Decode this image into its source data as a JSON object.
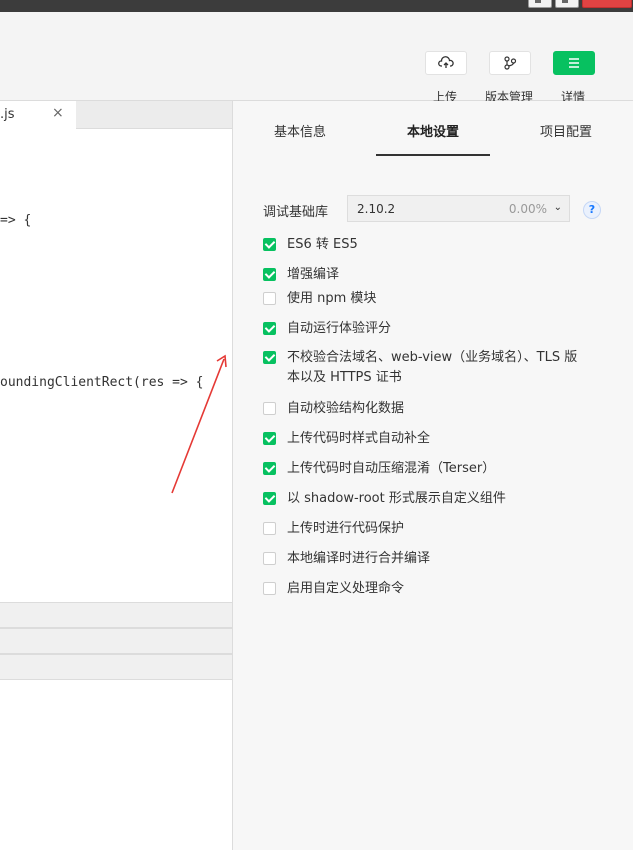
{
  "toolbar": {
    "upload_label": "上传",
    "version_label": "版本管理",
    "details_label": "详情"
  },
  "editor": {
    "tab_name": ".js",
    "tab_close": "×",
    "code_lines": [
      "=> {",
      "oundingClientRect(res => {"
    ]
  },
  "settings": {
    "tabs": [
      {
        "label": "基本信息"
      },
      {
        "label": "本地设置"
      },
      {
        "label": "项目配置"
      }
    ],
    "active_tab": "本地设置",
    "lib_label": "调试基础库",
    "lib_version": "2.10.2",
    "lib_percent": "0.00%",
    "help": "?",
    "options": [
      {
        "label": "ES6 转 ES5",
        "checked": true
      },
      {
        "label": "增强编译",
        "checked": true
      },
      {
        "label": "使用 npm 模块",
        "checked": false
      },
      {
        "label": "自动运行体验评分",
        "checked": true
      },
      {
        "label": "不校验合法域名、web-view（业务域名）、TLS 版本以及 HTTPS 证书",
        "checked": true
      },
      {
        "label": "自动校验结构化数据",
        "checked": false
      },
      {
        "label": "上传代码时样式自动补全",
        "checked": true
      },
      {
        "label": "上传代码时自动压缩混淆（Terser）",
        "checked": true
      },
      {
        "label": "以 shadow-root 形式展示自定义组件",
        "checked": true
      },
      {
        "label": "上传时进行代码保护",
        "checked": false
      },
      {
        "label": "本地编译时进行合并编译",
        "checked": false
      },
      {
        "label": "启用自定义处理命令",
        "checked": false
      }
    ]
  },
  "colors": {
    "accent": "#07c160",
    "annotation": "#e53935"
  }
}
